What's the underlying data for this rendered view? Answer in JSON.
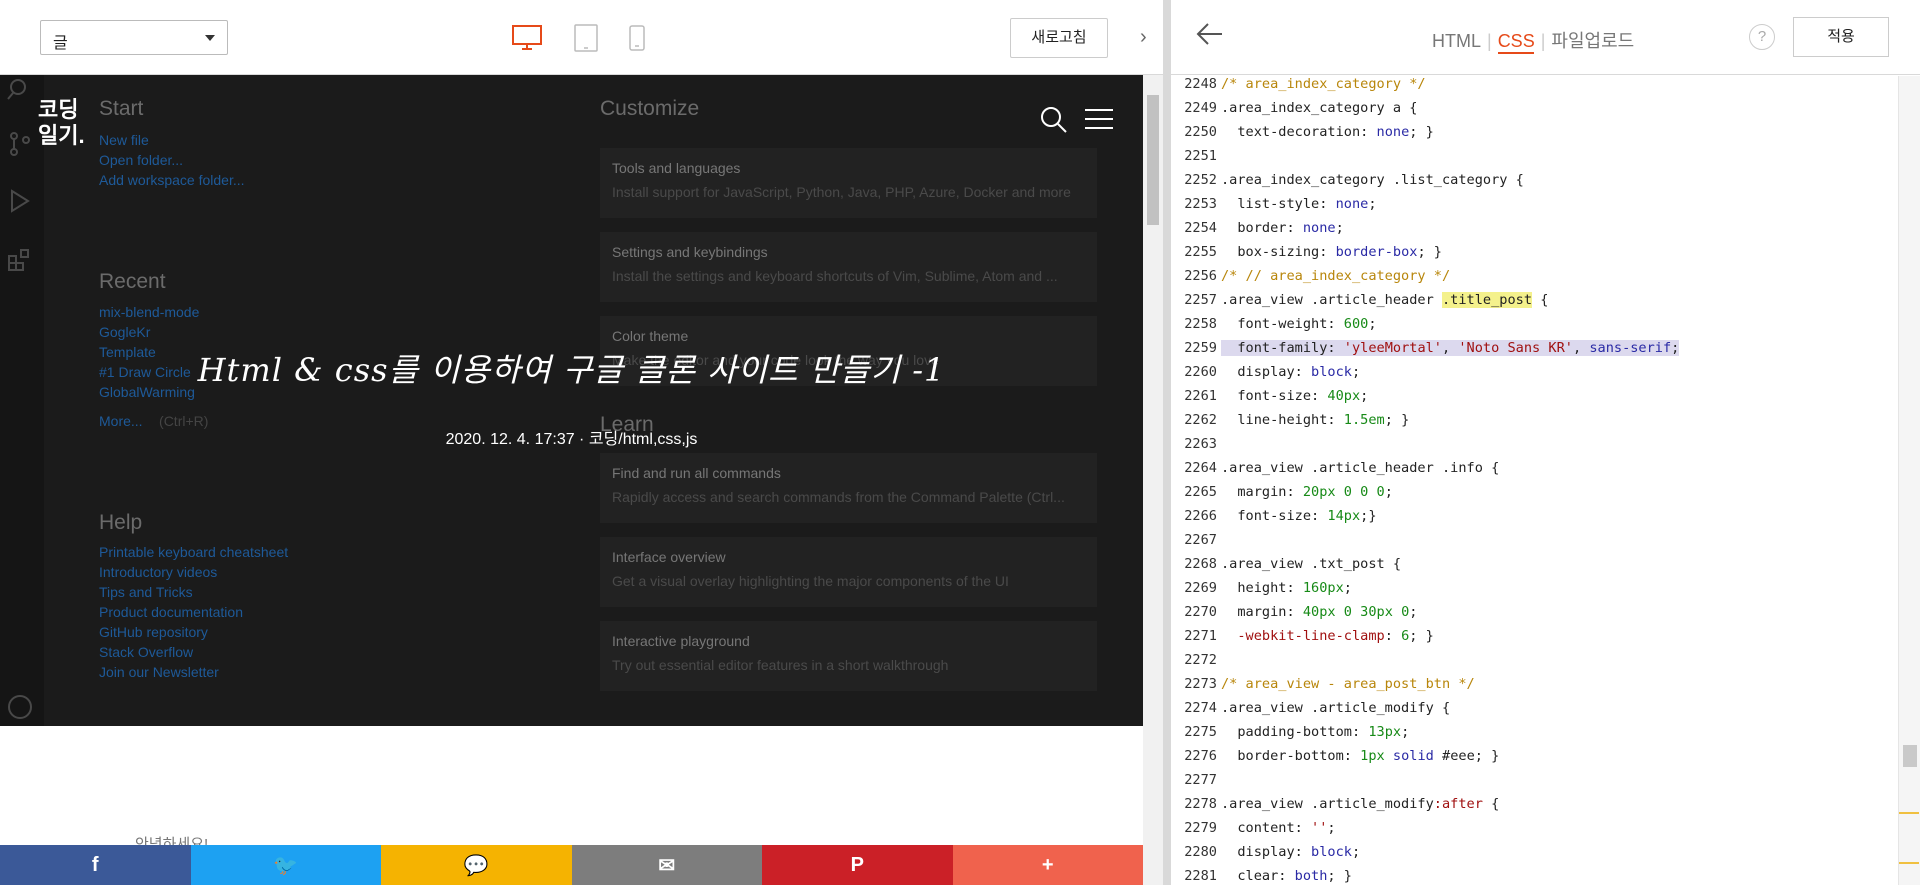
{
  "editor": {
    "select_value": "글",
    "refresh_label": "새로고침",
    "collapse_icon": "›",
    "devices": [
      "desktop-icon",
      "tablet-icon",
      "mobile-icon"
    ]
  },
  "preview": {
    "logo_line1": "코딩",
    "logo_line2": "일기.",
    "post_title": "Html & css를 이용하여 구글 클론 사이트 만들기 -1",
    "post_meta": "2020. 12. 4. 17:37 · 코딩/html,css,js",
    "body_peek": "안녕하세요!",
    "vscode": {
      "start": "Start",
      "start_links": [
        "New file",
        "Open folder...",
        "Add workspace folder..."
      ],
      "recent": "Recent",
      "recent_links": [
        "mix-blend-mode",
        "GogleKr",
        "Template",
        "#1 Draw Circle",
        "GlobalWarming"
      ],
      "more": "More...",
      "more_hint": "(Ctrl+R)",
      "help": "Help",
      "help_links": [
        "Printable keyboard cheatsheet",
        "Introductory videos",
        "Tips and Tricks",
        "Product documentation",
        "GitHub repository",
        "Stack Overflow",
        "Join our Newsletter"
      ],
      "customize": "Customize",
      "learn": "Learn",
      "cards": [
        {
          "title": "Tools and languages",
          "desc": "Install support for JavaScript, Python, Java, PHP, Azure, Docker and more"
        },
        {
          "title": "Settings and keybindings",
          "desc": "Install the settings and keyboard shortcuts of Vim, Sublime, Atom and ..."
        },
        {
          "title": "Color theme",
          "desc": "Make the editor and your code look the way you love"
        },
        {
          "title": "Find and run all commands",
          "desc": "Rapidly access and search commands from the Command Palette (Ctrl..."
        },
        {
          "title": "Interface overview",
          "desc": "Get a visual overlay highlighting the major components of the UI"
        },
        {
          "title": "Interactive playground",
          "desc": "Try out essential editor features in a short walkthrough"
        }
      ]
    },
    "share": [
      {
        "label": "f",
        "color": "#3b5998",
        "name": "facebook-share-button"
      },
      {
        "label": "🐦",
        "color": "#1da1f2",
        "name": "twitter-share-button"
      },
      {
        "label": "💬",
        "color": "#f5b301",
        "name": "kakaostory-share-button"
      },
      {
        "label": "✉",
        "color": "#7d7d7d",
        "name": "email-share-button"
      },
      {
        "label": "P",
        "color": "#cb2027",
        "name": "pinterest-share-button"
      },
      {
        "label": "+",
        "color": "#f0624d",
        "name": "more-share-button"
      }
    ]
  },
  "panel": {
    "tabs": [
      "HTML",
      "CSS",
      "파일업로드"
    ],
    "active_tab": "CSS",
    "help_label": "?",
    "apply_label": "적용"
  },
  "code_lines": [
    {
      "n": "2248",
      "t": "/* area_index_category */"
    },
    {
      "n": "2249",
      "t": ".area_index_category a {"
    },
    {
      "n": "2250",
      "t": "  text-decoration: none; }"
    },
    {
      "n": "2251",
      "t": ""
    },
    {
      "n": "2252",
      "t": ".area_index_category .list_category {"
    },
    {
      "n": "2253",
      "t": "  list-style: none;"
    },
    {
      "n": "2254",
      "t": "  border: none;"
    },
    {
      "n": "2255",
      "t": "  box-sizing: border-box; }"
    },
    {
      "n": "2256",
      "t": "/* // area_index_category */"
    },
    {
      "n": "2257",
      "t": ".area_view .article_header .title_post {"
    },
    {
      "n": "2258",
      "t": "  font-weight: 600;"
    },
    {
      "n": "2259",
      "t": "  font-family: 'yleeMortal', 'Noto Sans KR', sans-serif;"
    },
    {
      "n": "2260",
      "t": "  display: block;"
    },
    {
      "n": "2261",
      "t": "  font-size: 40px;"
    },
    {
      "n": "2262",
      "t": "  line-height: 1.5em; }"
    },
    {
      "n": "2263",
      "t": ""
    },
    {
      "n": "2264",
      "t": ".area_view .article_header .info {"
    },
    {
      "n": "2265",
      "t": "  margin: 20px 0 0 0;"
    },
    {
      "n": "2266",
      "t": "  font-size: 14px;}"
    },
    {
      "n": "2267",
      "t": ""
    },
    {
      "n": "2268",
      "t": ".area_view .txt_post {"
    },
    {
      "n": "2269",
      "t": "  height: 160px;"
    },
    {
      "n": "2270",
      "t": "  margin: 40px 0 30px 0;"
    },
    {
      "n": "2271",
      "t": "  -webkit-line-clamp: 6; }"
    },
    {
      "n": "2272",
      "t": ""
    },
    {
      "n": "2273",
      "t": "/* area_view - area_post_btn */"
    },
    {
      "n": "2274",
      "t": ".area_view .article_modify {"
    },
    {
      "n": "2275",
      "t": "  padding-bottom: 13px;"
    },
    {
      "n": "2276",
      "t": "  border-bottom: 1px solid #eee; }"
    },
    {
      "n": "2277",
      "t": ""
    },
    {
      "n": "2278",
      "t": ".area_view .article_modify:after {"
    },
    {
      "n": "2279",
      "t": "  content: '';"
    },
    {
      "n": "2280",
      "t": "  display: block;"
    },
    {
      "n": "2281",
      "t": "  clear: both; }"
    }
  ],
  "colors": {
    "accent": "#e64a19",
    "highlight_line": "#dcd9ee",
    "match_highlight": "#f4f18c"
  }
}
